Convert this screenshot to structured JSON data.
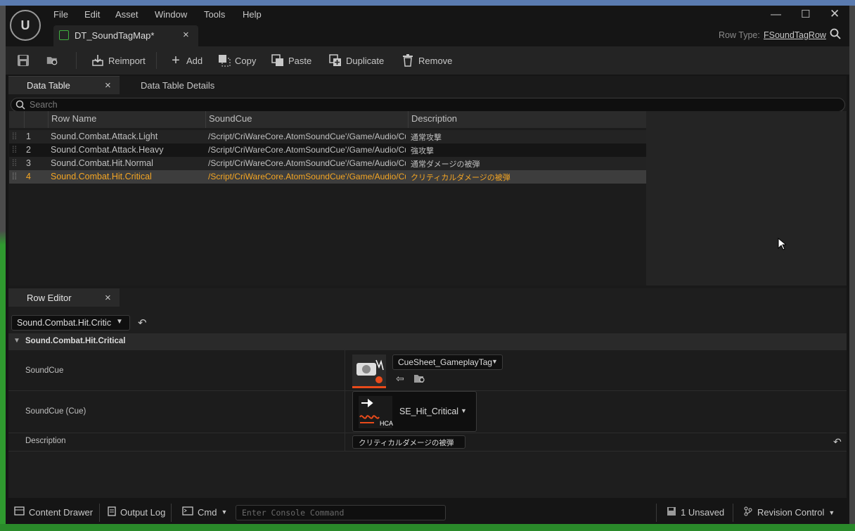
{
  "menu": {
    "items": [
      "File",
      "Edit",
      "Asset",
      "Window",
      "Tools",
      "Help"
    ]
  },
  "doc_tab": {
    "title": "DT_SoundTagMap*",
    "close": "×"
  },
  "row_type": {
    "label": "Row Type:",
    "value": "FSoundTagRow"
  },
  "toolbar": {
    "reimport": "Reimport",
    "add": "Add",
    "copy": "Copy",
    "paste": "Paste",
    "duplicate": "Duplicate",
    "remove": "Remove"
  },
  "panel_tabs": {
    "data_table": "Data Table",
    "details": "Data Table Details",
    "close": "×"
  },
  "search": {
    "placeholder": "Search"
  },
  "table": {
    "headers": [
      "Row Name",
      "SoundCue",
      "Description"
    ],
    "rows": [
      {
        "idx": "1",
        "name": "Sound.Combat.Attack.Light",
        "cue": "/Script/CriWareCore.AtomSoundCue'/Game/Audio/CueSheet_GameplayTag",
        "desc": "通常攻撃"
      },
      {
        "idx": "2",
        "name": "Sound.Combat.Attack.Heavy",
        "cue": "/Script/CriWareCore.AtomSoundCue'/Game/Audio/CueSheet_GameplayTag",
        "desc": "強攻撃"
      },
      {
        "idx": "3",
        "name": "Sound.Combat.Hit.Normal",
        "cue": "/Script/CriWareCore.AtomSoundCue'/Game/Audio/CueSheet_GameplayTag",
        "desc": "通常ダメージの被弾"
      },
      {
        "idx": "4",
        "name": "Sound.Combat.Hit.Critical",
        "cue": "/Script/CriWareCore.AtomSoundCue'/Game/Audio/CueSheet_GameplayTag",
        "desc": "クリティカルダメージの被弾"
      }
    ]
  },
  "row_editor": {
    "tab": "Row Editor",
    "close": "×",
    "selected_row": "Sound.Combat.Hit.Critic",
    "section": "Sound.Combat.Hit.Critical",
    "props": {
      "soundcue_label": "SoundCue",
      "soundcue_value": "CueSheet_GameplayTag",
      "cue_label": "SoundCue (Cue)",
      "cue_value": "SE_Hit_Critical",
      "cue_badge": "HCA",
      "desc_label": "Description",
      "desc_value": "クリティカルダメージの被弾"
    }
  },
  "statusbar": {
    "content_drawer": "Content Drawer",
    "output_log": "Output Log",
    "cmd": "Cmd",
    "console_placeholder": "Enter Console Command",
    "unsaved": "1 Unsaved",
    "revision": "Revision Control"
  },
  "colors": {
    "selected_text": "#f5a623",
    "accent_underline": "#e84a1a"
  }
}
